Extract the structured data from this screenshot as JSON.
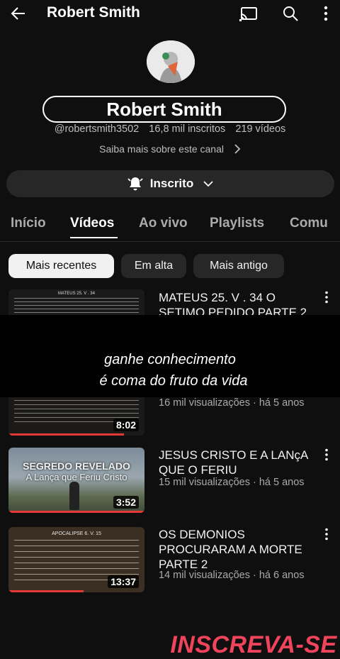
{
  "header": {
    "title": "Robert Smith"
  },
  "channel": {
    "name": "Robert Smith",
    "handle": "@robertsmith3502",
    "subscribers": "16,8 mil inscritos",
    "videos_count": "219 vídeos",
    "more_link": "Saiba mais sobre este canal",
    "subscribe_label": "Inscrito"
  },
  "tabs": [
    {
      "label": "Início"
    },
    {
      "label": "Vídeos"
    },
    {
      "label": "Ao vivo"
    },
    {
      "label": "Playlists"
    },
    {
      "label": "Comu"
    }
  ],
  "chips": [
    {
      "label": "Mais recentes"
    },
    {
      "label": "Em alta"
    },
    {
      "label": "Mais antigo"
    }
  ],
  "videos": [
    {
      "title": "MATEUS 25. V . 34  O SETIMO PEDIDO PARTE 2",
      "meta": "",
      "duration": "",
      "thumb_text": "MATEUS 25. V . 34"
    },
    {
      "title": "",
      "meta": "16 mil visualizações · há 5 anos",
      "duration": "8:02",
      "thumb_text": ""
    },
    {
      "title": "JESUS CRISTO E A LANçA QUE O FERIU",
      "meta": "15 mil visualizações · há 5 anos",
      "duration": "3:52",
      "thumb_text": "SEGREDO REVELADO",
      "thumb_text2": "A Lança que Feriu Cristo"
    },
    {
      "title": "OS DEMONIOS PROCURARAM A MORTE PARTE 2",
      "meta": "14 mil visualizações · há 6 anos",
      "duration": "13:37",
      "thumb_text": "APOCALIPSE 6. V. 15"
    }
  ],
  "overlay": {
    "cta": "INSCREVA-SE",
    "line1": "ganhe conhecimento",
    "line2": "é coma do fruto da vida"
  },
  "colors": {
    "accent": "#f0435c",
    "background": "#0f0f0f",
    "progress": "#e53935"
  }
}
